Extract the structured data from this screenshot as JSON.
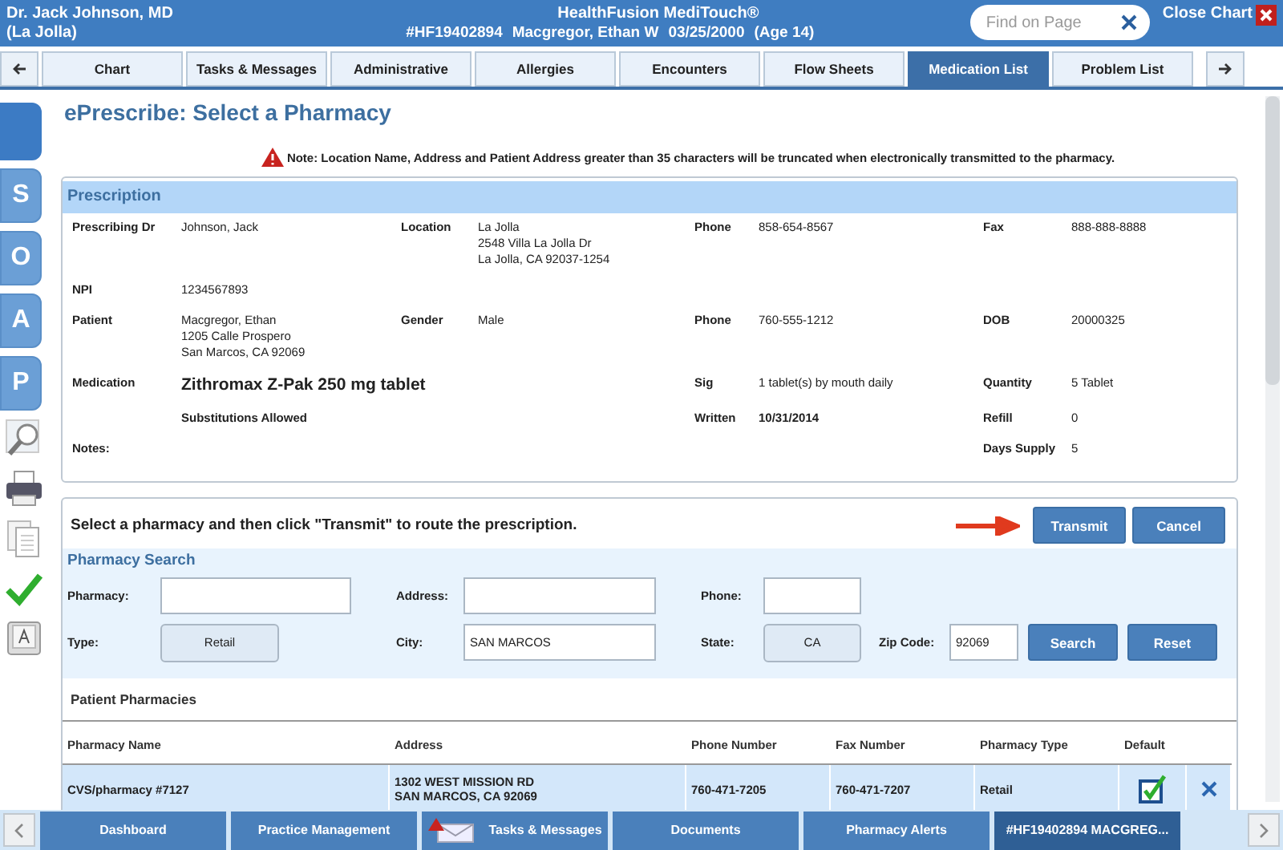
{
  "header": {
    "doctor": "Dr. Jack Johnson, MD",
    "location": "(La Jolla)",
    "app_title": "HealthFusion MediTouch®",
    "chart_number": "#HF19402894",
    "patient_name": "Macgregor, Ethan W",
    "dob": "03/25/2000",
    "age": "(Age 14)",
    "find_placeholder": "Find on Page",
    "close_label": "Close Chart"
  },
  "tabs": [
    {
      "label": "Chart",
      "selected": false
    },
    {
      "label": "Tasks & Messages",
      "selected": false
    },
    {
      "label": "Administrative",
      "selected": false
    },
    {
      "label": "Allergies",
      "selected": false
    },
    {
      "label": "Encounters",
      "selected": false
    },
    {
      "label": "Flow Sheets",
      "selected": false
    },
    {
      "label": "Medication List",
      "selected": true
    },
    {
      "label": "Problem List",
      "selected": false
    }
  ],
  "soap": [
    "S",
    "O",
    "A",
    "P"
  ],
  "page_title": "ePrescribe: Select a Pharmacy",
  "note": "Note: Location Name, Address and Patient Address greater than 35 characters will be truncated when electronically transmitted to the pharmacy.",
  "prescription": {
    "title": "Prescription",
    "rows": [
      {
        "column_1": {
          "label": "Prescribing Dr",
          "value": [
            "Johnson, Jack"
          ],
          "kind": "plain"
        },
        "column_2": {
          "label": "Location",
          "value": [
            "La Jolla",
            "2548 Villa La Jolla Dr",
            "La Jolla, CA 92037-1254"
          ],
          "kind": "plain"
        },
        "column_3": {
          "label": "Phone",
          "value": [
            "858-654-8567"
          ],
          "kind": "plain"
        },
        "column_4": {
          "label": "Fax",
          "value": [
            "888-888-8888"
          ],
          "kind": "plain"
        }
      },
      {
        "column_1": {
          "label": "NPI",
          "value": [
            "1234567893"
          ],
          "kind": "plain"
        }
      },
      {
        "column_1": {
          "label": "Patient",
          "value": [
            "Macgregor, Ethan",
            "1205 Calle Prospero",
            "San Marcos, CA 92069"
          ],
          "kind": "plain"
        },
        "column_2": {
          "label": "Gender",
          "value": [
            "Male"
          ],
          "kind": "plain"
        },
        "column_3": {
          "label": "Phone",
          "value": [
            "760-555-1212"
          ],
          "kind": "plain"
        },
        "column_4": {
          "label": "DOB",
          "value": [
            "20000325"
          ],
          "kind": "plain"
        }
      },
      {
        "column_1": {
          "label": "Medication",
          "value": [
            "Zithromax Z-Pak 250 mg tablet"
          ],
          "kind": "large"
        },
        "column_3": {
          "label": "Sig",
          "value": [
            "1 tablet(s) by mouth daily"
          ],
          "kind": "plain"
        },
        "column_4": {
          "label": "Quantity",
          "value": [
            "5 Tablet"
          ],
          "kind": "plain"
        }
      },
      {
        "column_1": {
          "value": [
            "Substitutions Allowed"
          ],
          "kind": "bold"
        },
        "column_3": {
          "label": "Written",
          "value": [
            "10/31/2014"
          ],
          "kind": "bold"
        },
        "column_4": {
          "label": "Refill",
          "value": [
            "0"
          ],
          "kind": "plain"
        }
      },
      {
        "column_1": {
          "label": "Notes:"
        },
        "column_4": {
          "label": "Days Supply",
          "value": [
            "5"
          ],
          "kind": "plain"
        }
      }
    ]
  },
  "instruction": "Select a pharmacy and then click \"Transmit\" to route the prescription.",
  "actions": [
    "Transmit",
    "Cancel"
  ],
  "search": {
    "title": "Pharmacy Search",
    "pharmacy_label": "Pharmacy:",
    "address_label": "Address:",
    "phone_label": "Phone:",
    "type_label": "Type:",
    "type_value": "Retail",
    "city_label": "City:",
    "city_value": "SAN MARCOS",
    "state_label": "State:",
    "state_value": "CA",
    "zip_label": "Zip Code:",
    "zip_value": "92069",
    "buttons": [
      "Search",
      "Reset"
    ]
  },
  "patient_pharmacies": {
    "title": "Patient Pharmacies",
    "columns": [
      "Pharmacy Name",
      "Address",
      "Phone Number",
      "Fax Number",
      "Pharmacy Type",
      "Default"
    ],
    "rows": [
      {
        "name": "CVS/pharmacy #7127",
        "address": [
          "1302 WEST MISSION RD",
          "SAN MARCOS, CA 92069"
        ],
        "phone": "760-471-7205",
        "fax": "760-471-7207",
        "type": "Retail",
        "default": true,
        "selected": true
      }
    ]
  },
  "bottom_tabs": [
    {
      "label": "Dashboard",
      "alert": false,
      "selected": false
    },
    {
      "label": "Practice Management",
      "alert": false,
      "selected": false
    },
    {
      "label": "Tasks & Messages",
      "alert": true,
      "selected": false
    },
    {
      "label": "Documents",
      "alert": false,
      "selected": false
    },
    {
      "label": "Pharmacy Alerts",
      "alert": false,
      "selected": false
    },
    {
      "label": "#HF19402894  MACGREG...",
      "alert": false,
      "selected": true
    }
  ]
}
